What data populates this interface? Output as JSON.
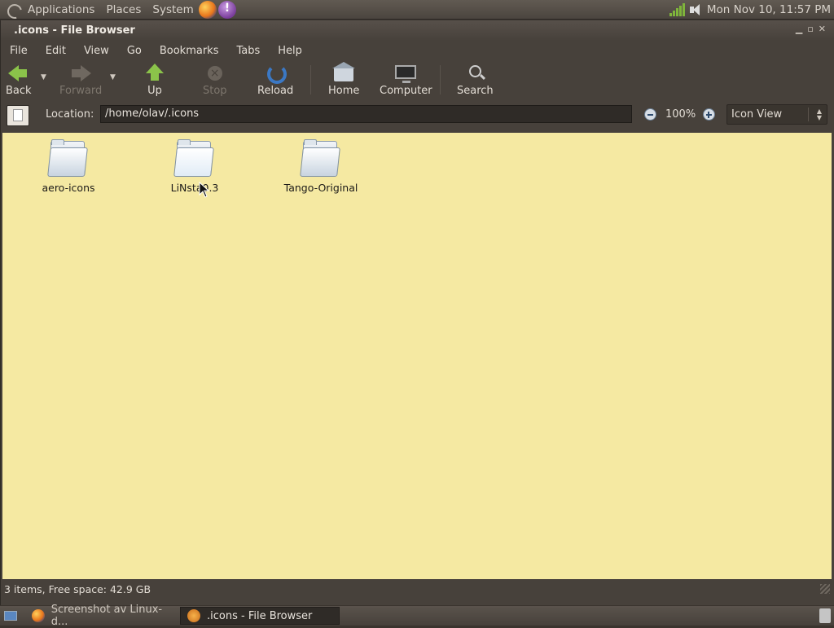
{
  "top_panel": {
    "menus": [
      "Applications",
      "Places",
      "System"
    ],
    "clock": "Mon Nov 10, 11:57 PM"
  },
  "window": {
    "title": ".icons - File Browser",
    "menubar": [
      {
        "label": "File"
      },
      {
        "label": "Edit"
      },
      {
        "label": "View"
      },
      {
        "label": "Go"
      },
      {
        "label": "Bookmarks"
      },
      {
        "label": "Tabs"
      },
      {
        "label": "Help"
      }
    ],
    "toolbar": {
      "back": "Back",
      "forward": "Forward",
      "up": "Up",
      "stop": "Stop",
      "reload": "Reload",
      "home": "Home",
      "computer": "Computer",
      "search": "Search"
    },
    "location": {
      "label": "Location:",
      "value": "/home/olav/.icons"
    },
    "zoom": "100%",
    "view_mode": "Icon View",
    "items": [
      {
        "name": "aero-icons"
      },
      {
        "name": "LiNsta0.3"
      },
      {
        "name": "Tango-Original"
      }
    ],
    "status": "3 items, Free space: 42.9 GB"
  },
  "taskbar": {
    "tasks": [
      {
        "label": "Screenshot av Linux-d..."
      },
      {
        "label": ".icons - File Browser"
      }
    ]
  },
  "colors": {
    "content_background": "#f5e9a2",
    "panel": "#4b453f",
    "accent_green": "#8bc34a"
  }
}
